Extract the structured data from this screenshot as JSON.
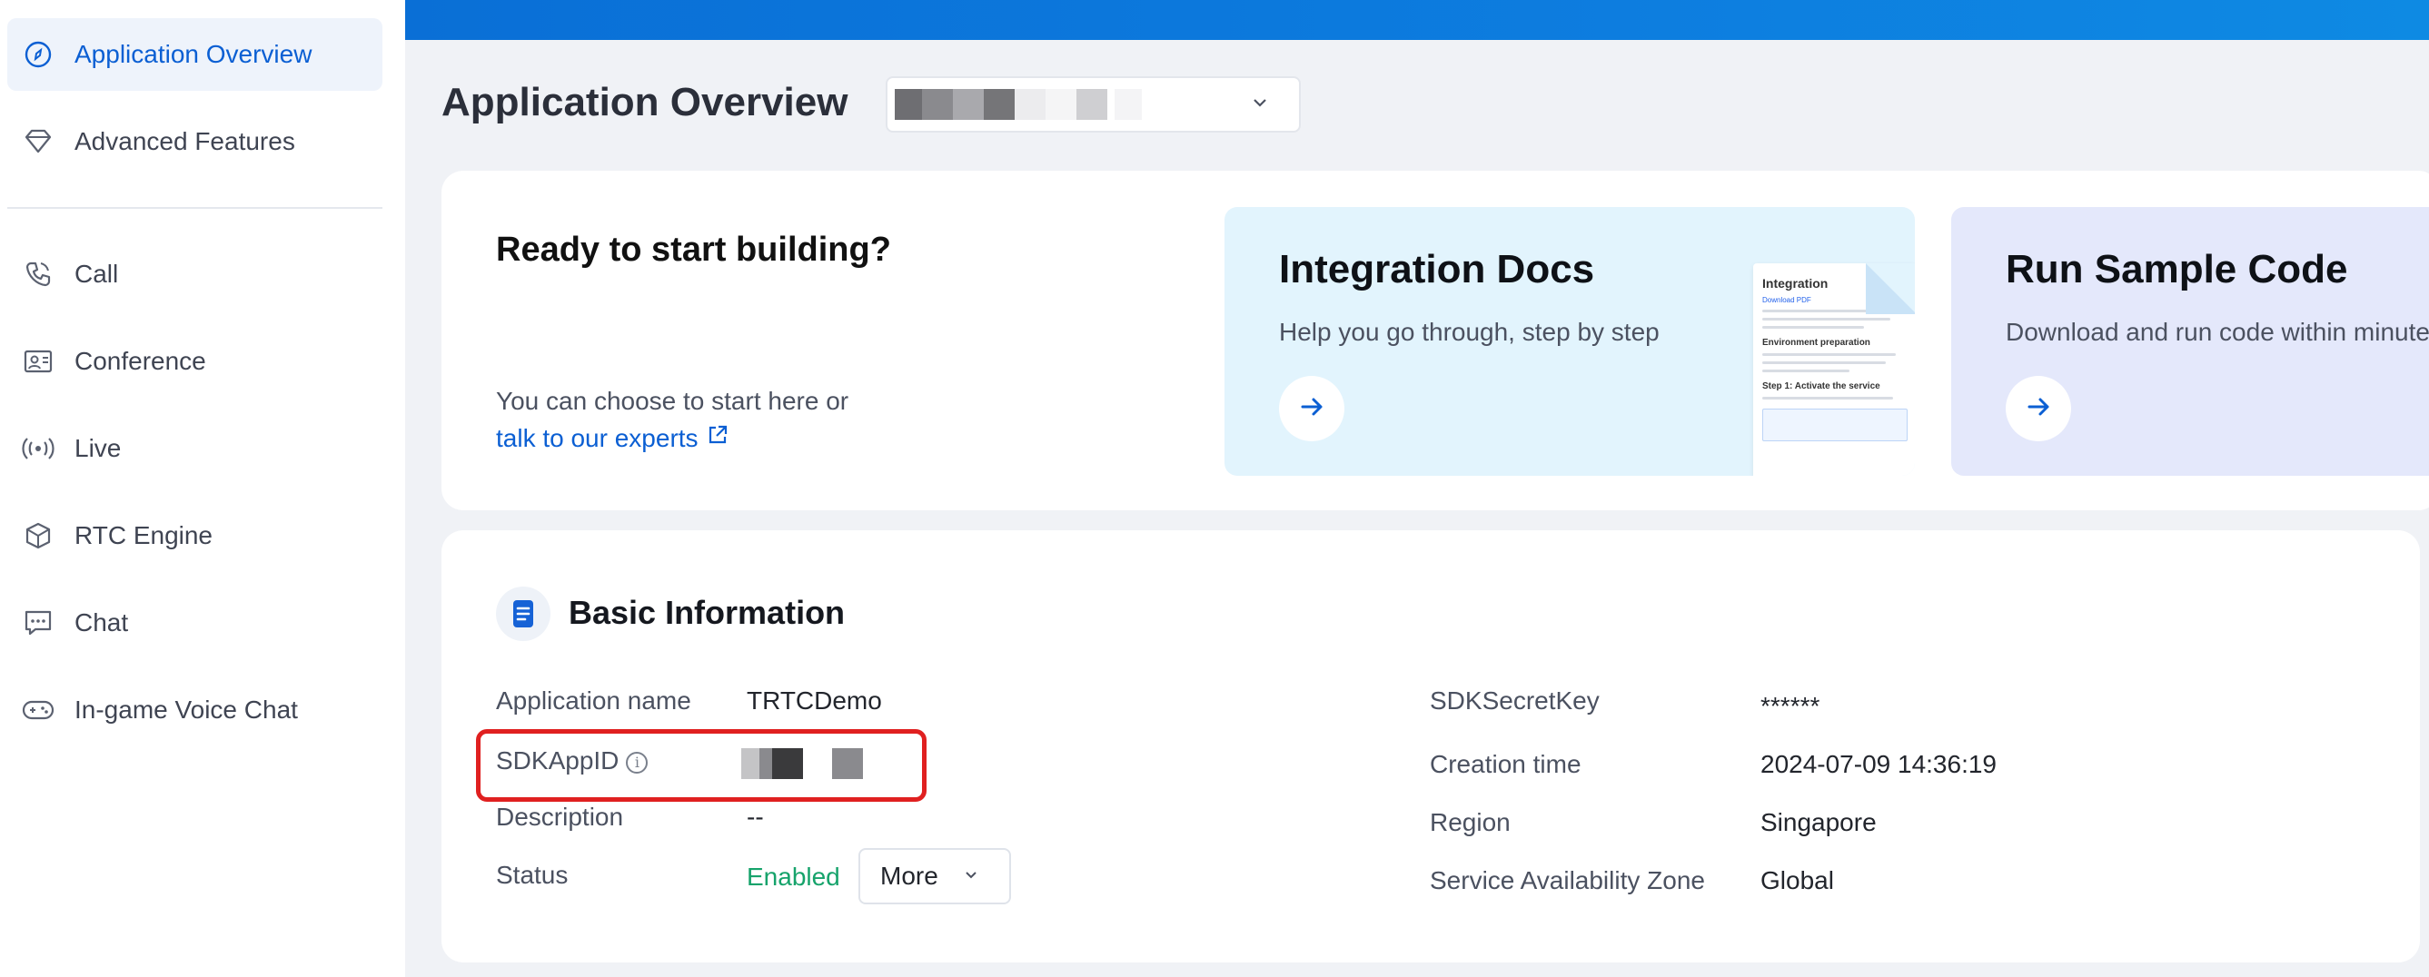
{
  "sidebar": {
    "items": [
      {
        "label": "Application Overview",
        "icon": "compass-icon",
        "active": true
      },
      {
        "label": "Advanced Features",
        "icon": "diamond-icon",
        "active": false
      },
      {
        "label": "Call",
        "icon": "phone-icon",
        "active": false
      },
      {
        "label": "Conference",
        "icon": "conference-icon",
        "active": false
      },
      {
        "label": "Live",
        "icon": "broadcast-icon",
        "active": false
      },
      {
        "label": "RTC Engine",
        "icon": "cube-icon",
        "active": false
      },
      {
        "label": "Chat",
        "icon": "chat-icon",
        "active": false
      },
      {
        "label": "In-game Voice Chat",
        "icon": "gamepad-icon",
        "active": false
      }
    ]
  },
  "header": {
    "title": "Application Overview",
    "app_select_icon": "chevron-down-icon"
  },
  "start": {
    "title": "Ready to start building?",
    "desc": "You can choose to start here or",
    "link": "talk to our experts",
    "link_icon": "external-link-icon"
  },
  "cards": {
    "docs": {
      "title": "Integration Docs",
      "subtitle": "Help you go through, step by step",
      "thumb_title": "Integration",
      "thumb_link": "Download PDF",
      "thumb_h1": "Environment preparation",
      "thumb_h2": "Step 1: Activate the service"
    },
    "sample": {
      "title": "Run Sample Code",
      "subtitle": "Download and run code within minutes"
    }
  },
  "basic_info": {
    "title": "Basic Information",
    "left": {
      "app_name_label": "Application name",
      "app_name_value": "TRTCDemo",
      "sdkappid_label": "SDKAppID",
      "description_label": "Description",
      "description_value": "--",
      "status_label": "Status",
      "status_value": "Enabled",
      "more_label": "More"
    },
    "right": {
      "secret_label": "SDKSecretKey",
      "secret_value": "******",
      "creation_label": "Creation time",
      "creation_value": "2024-07-09 14:36:19",
      "region_label": "Region",
      "region_value": "Singapore",
      "zone_label": "Service Availability Zone",
      "zone_value": "Global"
    }
  },
  "colors": {
    "accent": "#0b5fd3",
    "status_enabled": "#16a36b",
    "highlight": "#e02020",
    "topbar": "#0a6fd6"
  }
}
